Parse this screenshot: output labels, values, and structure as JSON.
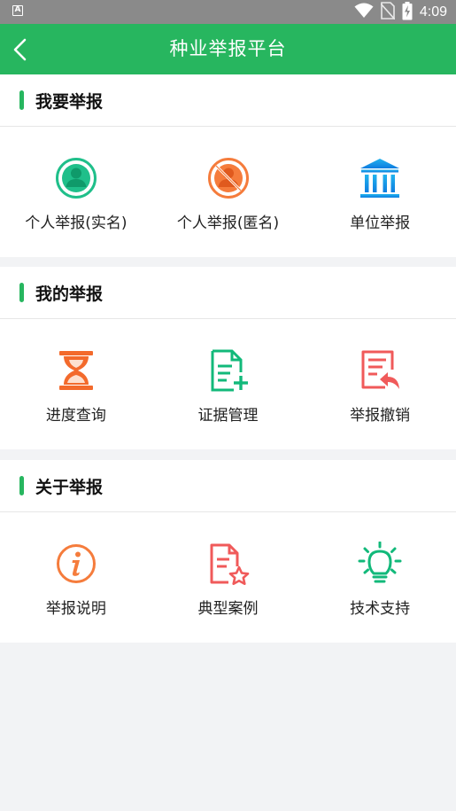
{
  "status_bar": {
    "time": "4:09",
    "left_icon": "a-notification-icon",
    "right_icons": [
      "wifi-icon",
      "no-sim-icon",
      "battery-charging-icon"
    ]
  },
  "header": {
    "title": "种业举报平台",
    "back_icon": "chevron-left-icon"
  },
  "sections": [
    {
      "title": "我要举报",
      "items": [
        {
          "label": "个人举报(实名)",
          "icon": "person-circle-icon",
          "color": "#1fbf8a"
        },
        {
          "label": "个人举报(匿名)",
          "icon": "anonymous-person-icon",
          "color": "#f57c3c"
        },
        {
          "label": "单位举报",
          "icon": "institution-building-icon",
          "color": "#1597e5"
        }
      ]
    },
    {
      "title": "我的举报",
      "items": [
        {
          "label": "进度查询",
          "icon": "hourglass-icon",
          "color": "#f36a2c"
        },
        {
          "label": "证据管理",
          "icon": "document-add-icon",
          "color": "#12b97a"
        },
        {
          "label": "举报撤销",
          "icon": "document-undo-icon",
          "color": "#f05a5a"
        }
      ]
    },
    {
      "title": "关于举报",
      "items": [
        {
          "label": "举报说明",
          "icon": "info-circle-icon",
          "color": "#f57c3c"
        },
        {
          "label": "典型案例",
          "icon": "document-star-icon",
          "color": "#f05a5a"
        },
        {
          "label": "技术支持",
          "icon": "lightbulb-icon",
          "color": "#12b97a"
        }
      ]
    }
  ],
  "colors": {
    "primary": "#27b65f",
    "page_background": "#f2f3f5"
  }
}
